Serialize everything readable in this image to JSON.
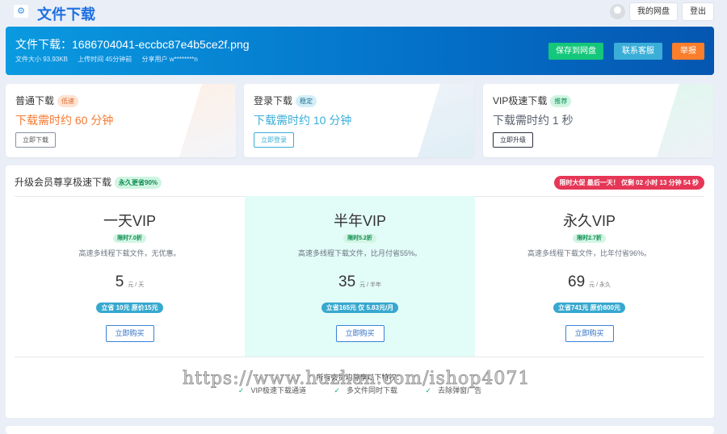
{
  "header": {
    "title": "文件下载",
    "my_disk": "我的网盘",
    "logout": "登出"
  },
  "file": {
    "name_label": "文件下载：",
    "name": "1686704041-eccbc87e4b5ce2f.png",
    "size": "文件大小 93.93KB",
    "uploaded": "上传时间 45分钟前",
    "sharer": "分享用户 w********n",
    "save_btn": "保存到网盘",
    "contact_btn": "联系客服",
    "report_btn": "举报"
  },
  "modes": [
    {
      "title": "普通下载",
      "badge": "低速",
      "time": "下载需时约 60 分钟",
      "button": "立即下载"
    },
    {
      "title": "登录下载",
      "badge": "稳定",
      "time": "下载需时约 10 分钟",
      "button": "立即登录"
    },
    {
      "title": "VIP极速下载",
      "badge": "推荐",
      "time": "下载需时约 1 秒",
      "button": "立即升级"
    }
  ],
  "upgrade": {
    "title": "升级会员尊享极速下载",
    "badge": "永久更省90%",
    "timer": "限时大促 最后一天！ 仅剩 02 小时 13 分钟 54 秒",
    "plans": [
      {
        "name": "一天VIP",
        "discount": "限时7.0折",
        "desc": "高速多线程下载文件，无优惠。",
        "price": "5",
        "unit": "元 / 天",
        "save": "立省 10元 原价15元",
        "buy": "立即购买"
      },
      {
        "name": "半年VIP",
        "discount": "限时5.2折",
        "desc": "高速多线程下载文件，比月付省55%。",
        "price": "35",
        "unit": "元 / 半年",
        "save": "立省165元 仅 5.83元/月",
        "buy": "立即购买"
      },
      {
        "name": "永久VIP",
        "discount": "限时2.7折",
        "desc": "高速多线程下载文件，比年付省96%。",
        "price": "69",
        "unit": "元 / 永久",
        "save": "立省741元 原价800元",
        "buy": "立即购买"
      }
    ],
    "perks_title": "所有会员均尊享以下特权：",
    "perks": [
      "VIP极速下载通道",
      "多文件同时下载",
      "去除弹窗广告"
    ]
  },
  "watermark": "https://www.huzhan.com/ishop4071"
}
